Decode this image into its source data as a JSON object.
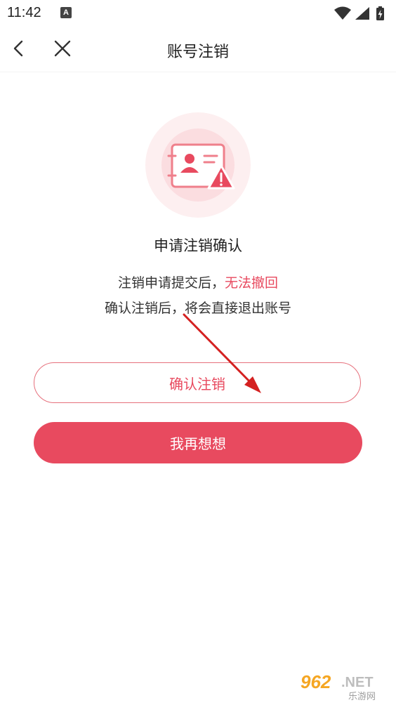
{
  "status_bar": {
    "time": "11:42",
    "app_icon_letter": "A",
    "icons": [
      "wifi-icon",
      "cellular-signal-icon",
      "battery-charging-icon"
    ]
  },
  "nav": {
    "title": "账号注销",
    "back_icon": "chevron-left-icon",
    "close_icon": "close-icon"
  },
  "content": {
    "confirm_title": "申请注销确认",
    "desc_line1_prefix": "注销申请提交后，",
    "desc_line1_warning": "无法撤回",
    "desc_line2": "确认注销后，将会直接退出账号"
  },
  "buttons": {
    "confirm_label": "确认注销",
    "cancel_label": "我再想想"
  },
  "watermark": {
    "main": "962.NET",
    "sub": "乐游网"
  },
  "colors": {
    "accent": "#e84a5f",
    "hero_circle_outer": "#fdeff0",
    "hero_circle_inner": "#fbdde0"
  }
}
